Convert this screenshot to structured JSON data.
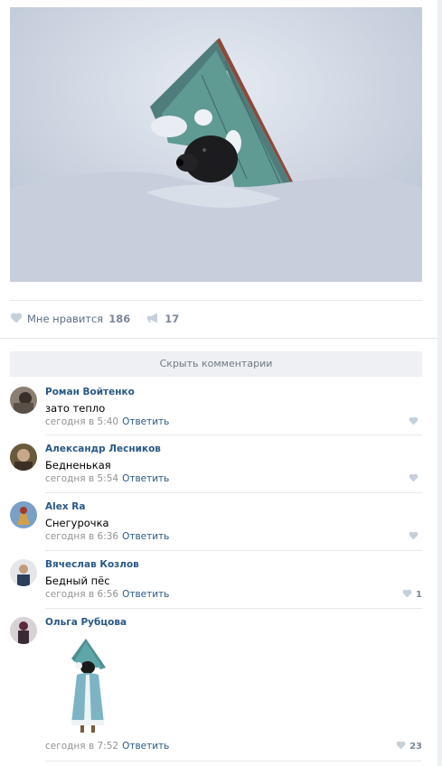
{
  "post": {
    "likes": {
      "label": "Мне нравится",
      "count": "186",
      "icon": "heart-icon"
    },
    "shares": {
      "count": "17",
      "icon": "megaphone-icon"
    }
  },
  "comments_section": {
    "hide_label": "Скрыть комментарии",
    "reply_label": "Ответить",
    "items": [
      {
        "author": "Роман Войтенко",
        "text": "зато тепло",
        "time": "сегодня в 5:40",
        "likes": ""
      },
      {
        "author": "Александр Лесников",
        "text": "Бедненькая",
        "time": "сегодня в 5:54",
        "likes": ""
      },
      {
        "author": "Alex Ra",
        "text": "Снегурочка",
        "time": "сегодня в 6:36",
        "likes": ""
      },
      {
        "author": "Вячеслав Козлов",
        "text": "Бедный пёс",
        "time": "сегодня в 6:56",
        "likes": "1"
      },
      {
        "author": "Ольга Рубцова",
        "text": "",
        "time": "сегодня в 7:52",
        "likes": "23",
        "attachment": "sticker-dog-snow-maiden"
      }
    ]
  },
  "colors": {
    "link": "#2a5885",
    "muted": "#939393",
    "divider": "#e7e8ec",
    "button_bg": "#eef0f3"
  }
}
